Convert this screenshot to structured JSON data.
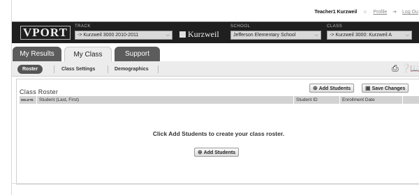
{
  "userbar": {
    "username": "Teacher1 Kurzweil",
    "profile_label": "Profile",
    "logout_label": "Log Ou"
  },
  "brand": {
    "logo_text": "VPORT",
    "kurzweil_text": "Kurzweil"
  },
  "selectors": {
    "track": {
      "label": "TRACK",
      "value": "-> Kurzweil 3000 2010-2011"
    },
    "school": {
      "label": "SCHOOL",
      "value": "Jefferson Elementary School"
    },
    "class": {
      "label": "CLASS",
      "value": "-> Kurzweil 3000: Kurzweil A"
    }
  },
  "tabs": [
    {
      "label": "My Results",
      "active": false
    },
    {
      "label": "My Class",
      "active": true
    },
    {
      "label": "Support",
      "active": false
    }
  ],
  "subnav": [
    {
      "label": "Roster",
      "active": true
    },
    {
      "label": "Class Settings",
      "active": false
    },
    {
      "label": "Demographics",
      "active": false
    }
  ],
  "toolbar_icons": [
    "print-icon",
    "help-icon",
    "book-icon"
  ],
  "roster": {
    "title": "Class Roster",
    "add_students_label": "Add Students",
    "save_changes_label": "Save Changes",
    "columns": [
      "DELETE",
      "Student (Last, First)",
      "Student ID",
      "Enrollment Date"
    ],
    "empty_message": "Click Add Students to create your class roster.",
    "add_students_center_label": "Add Students"
  },
  "colors": {
    "topbar": "#1f1f1f",
    "tab_dark": "#5c5c5c",
    "subnav_bg": "#ececec",
    "header_bg": "#d2d2d2"
  }
}
